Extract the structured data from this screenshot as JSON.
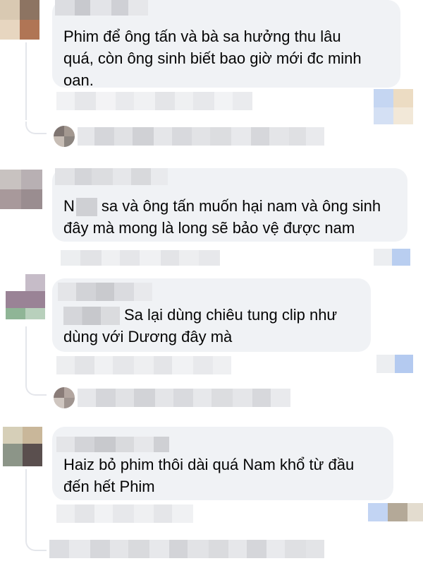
{
  "comments": [
    {
      "text": "Phim để ông tấn và bà sa hưởng thu lâu\nquá, còn ông sinh biết bao giờ mới đc minh\noan."
    },
    {
      "text_prefix": "N",
      "text": "sa và ông tấn muốn hại nam và ông sinh\nđây mà mong là long sẽ bảo vệ được nam"
    },
    {
      "text": "Sa lại dùng chiêu tung clip như\ndùng với Dương đây mà"
    },
    {
      "text": "Haiz bỏ phim thôi dài quá Nam khổ từ đầu\nđến hết Phim"
    }
  ],
  "colors": {
    "bubble": "#f0f2f5",
    "text": "#050505",
    "thread_line": "#e4e6eb",
    "reaction_blue": "#c5d6f2",
    "reaction_tan": "#ecdcc3"
  }
}
